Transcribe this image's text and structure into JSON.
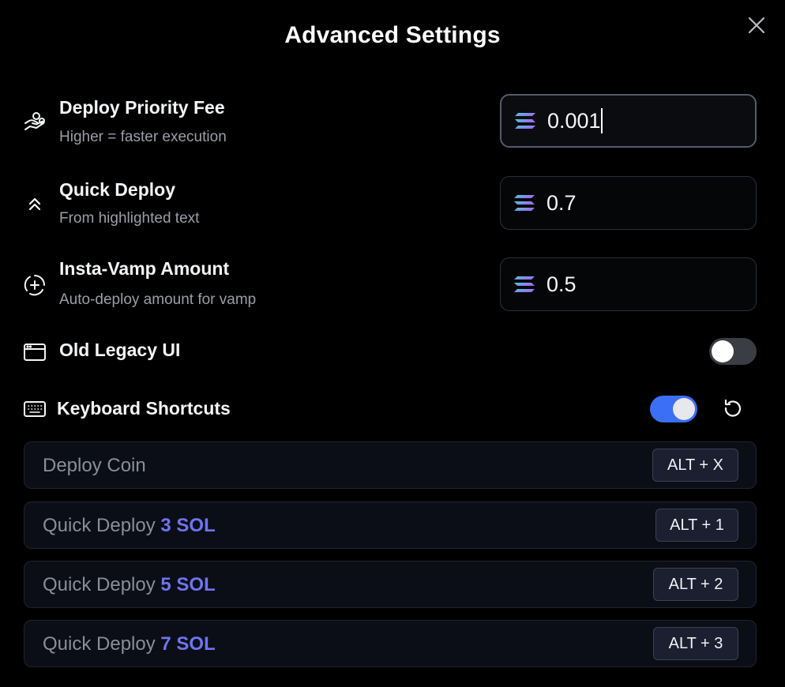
{
  "dialog": {
    "title": "Advanced Settings",
    "close_icon": "close-icon"
  },
  "settings": [
    {
      "label": "Deploy Priority Fee",
      "sub": "Higher = faster execution",
      "icon": "hand-coins-icon",
      "value": "0.001",
      "focused": true
    },
    {
      "label": "Quick Deploy",
      "sub": "From highlighted text",
      "icon": "double-chevron-up-icon",
      "value": "0.7"
    },
    {
      "label": "Insta-Vamp Amount",
      "sub": "Auto-deploy amount for vamp",
      "icon": "circle-plus-dashed-icon",
      "value": "0.5"
    }
  ],
  "legacy_ui": {
    "label": "Old Legacy UI",
    "icon": "browser-window-icon",
    "enabled": false
  },
  "keyboard_shortcuts": {
    "label": "Keyboard Shortcuts",
    "icon": "keyboard-icon",
    "enabled": true,
    "reset_icon": "reset-icon",
    "items": [
      {
        "prefix": "Deploy Coin",
        "accent": "",
        "keys": "ALT + X"
      },
      {
        "prefix": "Quick Deploy ",
        "accent": "3 SOL",
        "keys": "ALT + 1"
      },
      {
        "prefix": "Quick Deploy ",
        "accent": "5 SOL",
        "keys": "ALT + 2"
      },
      {
        "prefix": "Quick Deploy ",
        "accent": "7 SOL",
        "keys": "ALT + 3"
      }
    ]
  },
  "colors": {
    "background": "#000000",
    "accent_blue": "#3b6ff5",
    "accent_purple": "#6f74f0",
    "muted_text": "#9b9ea6"
  }
}
